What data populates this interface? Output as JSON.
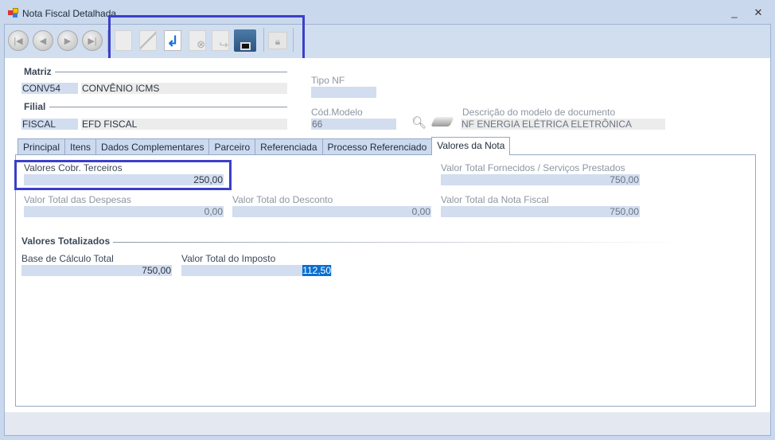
{
  "window": {
    "title": "Nota Fiscal Detalhada",
    "minimize": "_",
    "close": "✕"
  },
  "toolbar": {
    "first": "first-record",
    "prev": "previous-record",
    "next": "next-record",
    "last": "last-record"
  },
  "matriz": {
    "label": "Matriz",
    "code": "CONV54",
    "name": "CONVÊNIO ICMS"
  },
  "filial": {
    "label": "Filial",
    "code": "FISCAL",
    "name": "EFD FISCAL"
  },
  "tipo_nf": {
    "label": "Tipo NF",
    "value": ""
  },
  "cod_modelo": {
    "label": "Cód.Modelo",
    "value": "66"
  },
  "desc_modelo": {
    "label": "Descrição do modelo de documento",
    "value": "NF ENERGIA ELÉTRICA ELETRÔNICA"
  },
  "tabs": [
    "Principal",
    "Itens",
    "Dados Complementares",
    "Parceiro",
    "Referenciada",
    "Processo Referenciado",
    "Valores da Nota"
  ],
  "valores": {
    "cobr_terceiros": {
      "label": "Valores Cobr. Terceiros",
      "value": "250,00"
    },
    "total_fornecidos": {
      "label": "Valor Total Fornecidos / Serviços Prestados",
      "value": "750,00"
    },
    "total_despesas": {
      "label": "Valor Total das Despesas",
      "value": "0,00"
    },
    "total_desconto": {
      "label": "Valor Total do Desconto",
      "value": "0,00"
    },
    "total_nota": {
      "label": "Valor Total da Nota Fiscal",
      "value": "750,00"
    }
  },
  "totalizados": {
    "label": "Valores Totalizados",
    "base_calculo": {
      "label": "Base de Cálculo Total",
      "value": "750,00"
    },
    "total_imposto": {
      "label": "Valor Total do Imposto",
      "value": "112,50"
    }
  }
}
